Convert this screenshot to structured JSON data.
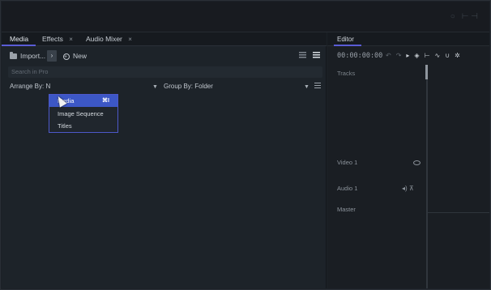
{
  "tabs": [
    {
      "label": "Media",
      "closable": false,
      "active": true
    },
    {
      "label": "Effects",
      "closable": true
    },
    {
      "label": "Audio Mixer",
      "closable": true
    }
  ],
  "toolbar": {
    "import_label": "Import...",
    "new_label": "New"
  },
  "search": {
    "placeholder": "Search in Pro"
  },
  "arrange": {
    "label": "Arrange By: N"
  },
  "group": {
    "label": "Group By: Folder"
  },
  "dropdown": {
    "items": [
      {
        "label": "Media",
        "shortcut": "⌘I",
        "selected": true
      },
      {
        "label": "Image Sequence"
      },
      {
        "label": "Titles"
      }
    ]
  },
  "editor": {
    "tab_label": "Editor",
    "timecode": "00:00:00:00",
    "tracks_label": "Tracks",
    "video_track": "Video 1",
    "audio_track": "Audio 1",
    "master_track": "Master"
  },
  "colors": {
    "accent": "#5a5cd6",
    "selection": "#3c57c6"
  }
}
